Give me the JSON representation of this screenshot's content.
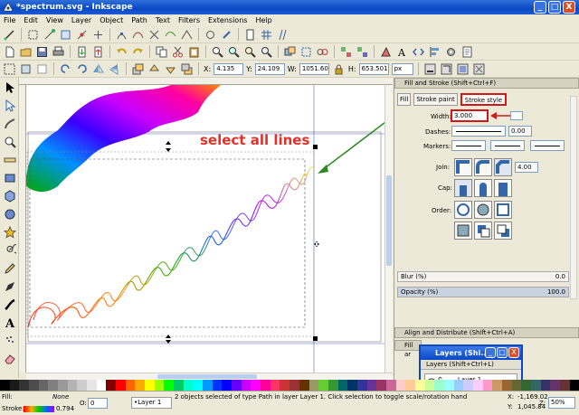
{
  "window": {
    "title": "*spectrum.svg - Inkscape",
    "minimize": "_",
    "maximize": "□",
    "close": "X"
  },
  "menu": [
    "File",
    "Edit",
    "View",
    "Layer",
    "Object",
    "Path",
    "Text",
    "Filters",
    "Extensions",
    "Help"
  ],
  "toolbar3": {
    "x_label": "X:",
    "x": "4.135",
    "y_label": "Y:",
    "y": "24.109",
    "w_label": "W:",
    "w": "1051.60",
    "h_label": "H:",
    "h": "653.501",
    "unit": "px"
  },
  "annotation": "select all lines",
  "fill_stroke": {
    "title": "Fill and Stroke (Shift+Ctrl+F)",
    "tabs": [
      "Fill",
      "Stroke paint",
      "Stroke style"
    ],
    "width_label": "Width:",
    "width_value": "3.000",
    "dashes_label": "Dashes:",
    "dashes_value": "0.00",
    "markers_label": "Markers:",
    "join_label": "Join:",
    "miter_value": "4.00",
    "cap_label": "Cap:",
    "order_label": "Order:",
    "blur_label": "Blur (%)",
    "blur_value": "0.0",
    "opacity_label": "Opacity (%)",
    "opacity_value": "100.0"
  },
  "dock_panels": {
    "align": "Align and Distribute (Shift+Ctrl+A)",
    "fill_short": "Fill ar"
  },
  "layers_window": {
    "title": "Layers (Shi...",
    "header": "Layers (Shift+Ctrl+L)",
    "layer": "Layer 1"
  },
  "status": {
    "fill_label": "Fill:",
    "fill_value": "None",
    "stroke_label": "Stroke:",
    "stroke_width": "0.794",
    "layer": "•Layer 1",
    "message": "2 objects selected of type Path in layer Layer 1. Click selection to toggle scale/rotation hand",
    "coord_x_label": "X:",
    "coord_x": "-1,169.02",
    "coord_y_label": "Y:",
    "coord_y": "1,045.84",
    "zoom_label": "Z:",
    "zoom": "50%",
    "opacity_label": "O:",
    "opacity": "0"
  },
  "colors": {
    "accent": "#0a48c4",
    "annotation": "#e0322b",
    "arrow": "#2a8a1f",
    "highlight_box": "#d11818"
  }
}
